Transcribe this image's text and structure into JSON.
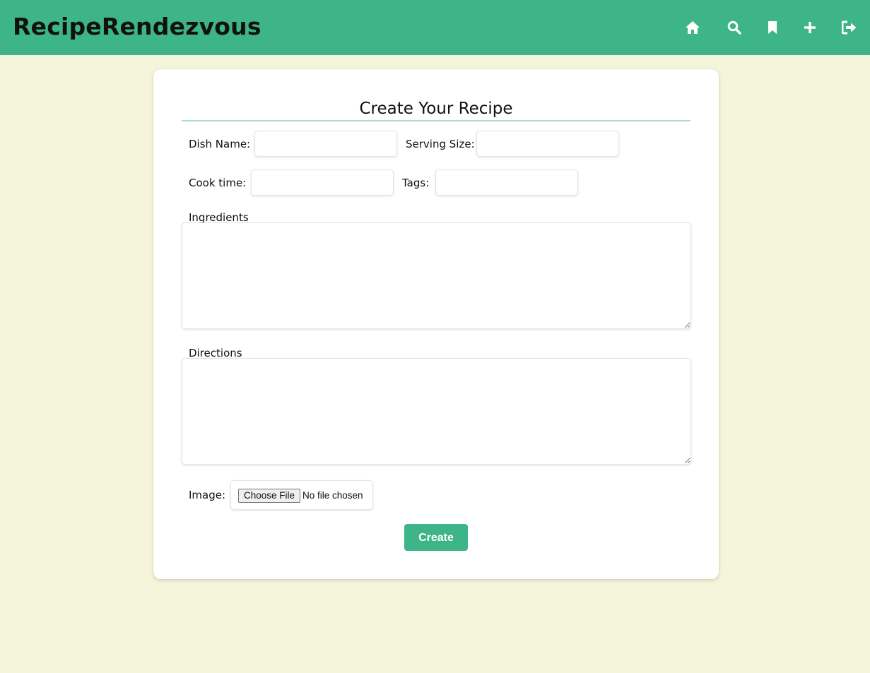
{
  "header": {
    "brand": "RecipeRendezvous",
    "nav": [
      {
        "icon": "home-icon"
      },
      {
        "icon": "search-icon"
      },
      {
        "icon": "bookmark-icon"
      },
      {
        "icon": "plus-icon"
      },
      {
        "icon": "sign-out-icon"
      }
    ]
  },
  "form": {
    "title": "Create Your Recipe",
    "dish_name_label": "Dish Name:",
    "dish_name_value": "",
    "serving_size_label": "Serving Size:",
    "serving_size_value": "",
    "cook_time_label": "Cook time:",
    "cook_time_value": "",
    "tags_label": "Tags:",
    "tags_value": "",
    "ingredients_label": "Ingredients",
    "ingredients_value": "",
    "directions_label": "Directions",
    "directions_value": "",
    "image_label": "Image:",
    "file_button_label": "Choose File",
    "file_status": "No file chosen",
    "submit_label": "Create"
  },
  "colors": {
    "accent": "#3eb489",
    "page_background": "#f5f5dc",
    "title_rule": "#a7dfc9"
  }
}
